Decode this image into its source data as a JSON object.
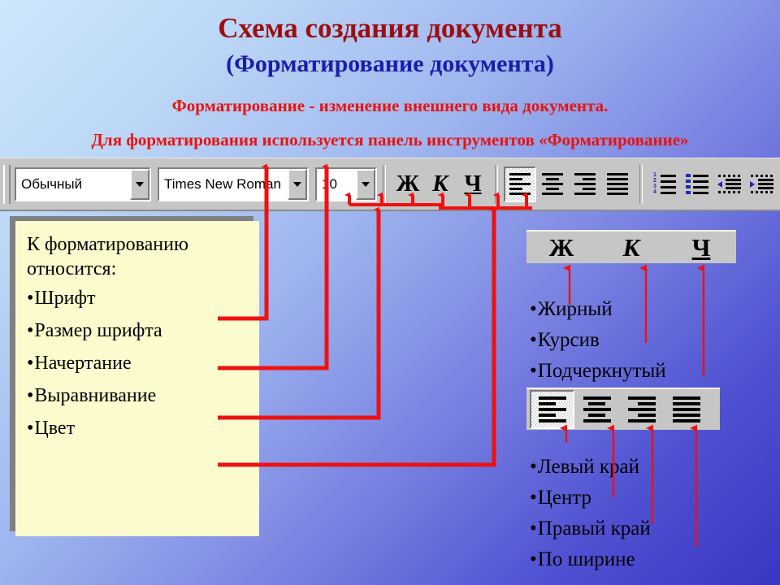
{
  "slide": {
    "title_main": "Схема создания документа",
    "title_sub": "(Форматирование документа)",
    "lead_1": "Форматирование - изменение внешнего вида документа.",
    "lead_2": "Для форматирования используется панель инструментов «Форматирование»",
    "colors": {
      "title_main": "#9c0e10",
      "title_sub": "#1d1dad",
      "lead": "#e8130f",
      "connector": "#ee1111",
      "note_bg": "#fcfbcd",
      "toolbar_bg": "#c6c6c6",
      "bg_from": "#cde6fb",
      "bg_to": "#3a36c3"
    }
  },
  "toolbar": {
    "grip_icon": "drag-grip-icon",
    "style_combo": {
      "value": "Обычный",
      "caret_icon": "chevron-down-icon"
    },
    "font_combo": {
      "value": "Times New Roman",
      "caret_icon": "chevron-down-icon"
    },
    "size_combo": {
      "value": "10",
      "caret_icon": "chevron-down-icon"
    },
    "bold_label": "Ж",
    "italic_label": "К",
    "underline_label": "Ч",
    "align_buttons": [
      {
        "name": "align-left-button",
        "icon": "align-left-icon",
        "pressed": true
      },
      {
        "name": "align-center-button",
        "icon": "align-center-icon",
        "pressed": false
      },
      {
        "name": "align-right-button",
        "icon": "align-right-icon",
        "pressed": false
      },
      {
        "name": "align-justify-button",
        "icon": "align-justify-icon",
        "pressed": false
      }
    ],
    "list_buttons": [
      {
        "name": "numbered-list-button",
        "icon": "numbered-list-icon"
      },
      {
        "name": "bulleted-list-button",
        "icon": "bulleted-list-icon"
      },
      {
        "name": "decrease-indent-button",
        "icon": "decrease-indent-icon"
      },
      {
        "name": "increase-indent-button",
        "icon": "increase-indent-icon"
      }
    ],
    "borders_button": {
      "name": "borders-button",
      "icon": "borders-grid-icon",
      "caret_icon": "chevron-down-icon"
    },
    "highlight_button": {
      "name": "highlight-button",
      "icon": "highlighter-pen-icon",
      "caret_icon": "chevron-down-icon",
      "swatch_color": "#ffffff"
    },
    "font_color_button": {
      "name": "font-color-button",
      "icon": "font-color-a-icon",
      "caret_icon": "chevron-down-icon",
      "swatch_color": "#f20000"
    }
  },
  "note": {
    "heading": "К форматированию относится:",
    "items": [
      "Шрифт",
      "Размер шрифта",
      "Начертание",
      "Выравнивание",
      "Цвет"
    ]
  },
  "panel_bic": {
    "buttons": [
      {
        "label": "Ж",
        "name": "bold-button"
      },
      {
        "label": "К",
        "name": "italic-button"
      },
      {
        "label": "Ч",
        "name": "underline-button"
      }
    ],
    "captions": [
      "Жирный",
      "Курсив",
      "Подчеркнутый"
    ]
  },
  "panel_align": {
    "buttons": [
      {
        "name": "align-left-button",
        "icon": "align-left-icon",
        "pressed": true
      },
      {
        "name": "align-center-button",
        "icon": "align-center-icon",
        "pressed": false
      },
      {
        "name": "align-right-button",
        "icon": "align-right-icon",
        "pressed": false
      },
      {
        "name": "align-justify-button",
        "icon": "align-justify-icon",
        "pressed": false
      }
    ],
    "captions": [
      "Левый край",
      "Центр",
      "Правый край",
      "По ширине"
    ]
  }
}
